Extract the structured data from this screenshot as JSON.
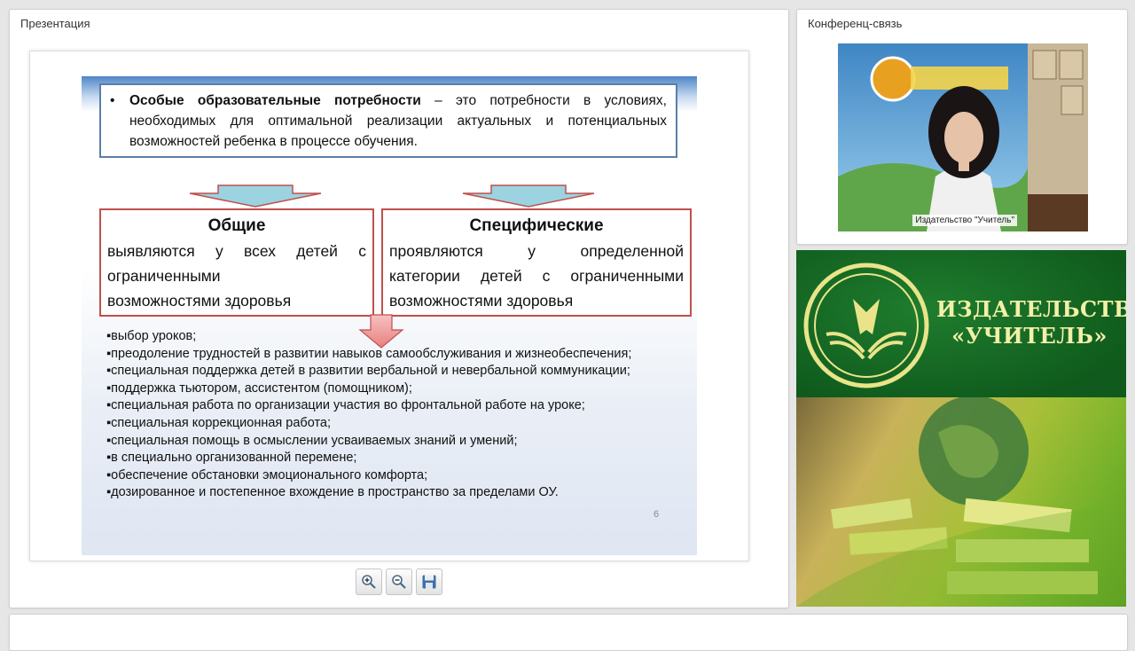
{
  "presentation_panel": {
    "title": "Презентация"
  },
  "conference_panel": {
    "title": "Конференц-связь",
    "video_caption": "Издательство \"Учитель\""
  },
  "slide": {
    "definition": {
      "bullet": "•",
      "term": "Особые образовательные потребности",
      "text": " – это потребности в условиях, необходимых для оптимальной реализации актуальных и потенциальных возможностей ребенка в процессе обучения."
    },
    "general": {
      "title": "Общие",
      "lines": [
        "выявляются у всех детей с",
        "ограниченными",
        "возможностями здоровья"
      ]
    },
    "specific": {
      "title": "Специфические",
      "lines": [
        "проявляются у определенной",
        "категории детей с ограниченными",
        "возможностями здоровья"
      ]
    },
    "needs": [
      "▪выбор уроков;",
      "▪преодоление трудностей в развитии навыков самообслуживания и жизнеобеспечения;",
      "▪специальная поддержка детей в развитии вербальной и невербальной коммуникации;",
      "▪поддержка тьютором,  ассистентом (помощником);",
      "▪специальная работа по организации участия во фронтальной работе на уроке;",
      "▪специальная коррекционная работа;",
      "▪специальная помощь в осмыслении усваиваемых знаний и умений;",
      "▪в специально организованной перемене;",
      "▪обеспечение обстановки эмоционального комфорта;",
      "▪дозированное и постепенное вхождение в  пространство за пределами ОУ."
    ],
    "page_number": "6"
  },
  "toolbar": {
    "zoom_in_icon": "zoom-in-icon",
    "zoom_out_icon": "zoom-out-icon",
    "save_icon": "floppy-disk-icon"
  },
  "banner": {
    "line1": "ИЗДАТЕЛЬСТВО",
    "line2": "«УЧИТЕЛЬ»",
    "colors": {
      "green": "#11611f",
      "text": "#f3f0a8"
    }
  }
}
